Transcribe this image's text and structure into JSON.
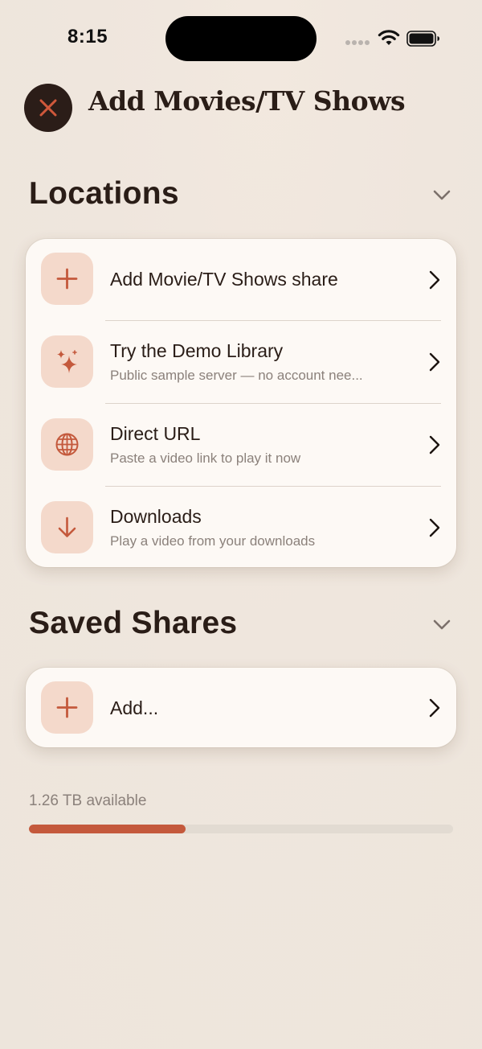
{
  "status_bar": {
    "time": "8:15"
  },
  "header": {
    "title": "Add Movies/TV Shows",
    "close_icon": "close-icon"
  },
  "colors": {
    "accent": "#c4593c",
    "icon_tile": "#f4d9cb",
    "dark": "#2b1d18",
    "card": "#fdf9f5",
    "track": "#e2dbd2"
  },
  "locations": {
    "title": "Locations",
    "items": [
      {
        "icon": "plus-icon",
        "title": "Add Movie/TV Shows share",
        "subtitle": ""
      },
      {
        "icon": "sparkles-icon",
        "title": "Try the Demo Library",
        "subtitle": "Public sample server — no account nee..."
      },
      {
        "icon": "globe-icon",
        "title": "Direct URL",
        "subtitle": "Paste a video link to play it now"
      },
      {
        "icon": "download-arrow-icon",
        "title": "Downloads",
        "subtitle": "Play a video from your downloads"
      }
    ]
  },
  "saved_shares": {
    "title": "Saved Shares",
    "items": [
      {
        "icon": "plus-icon",
        "title": "Add..."
      }
    ]
  },
  "storage": {
    "label": "1.26 TB available",
    "used_fraction": 0.37
  }
}
